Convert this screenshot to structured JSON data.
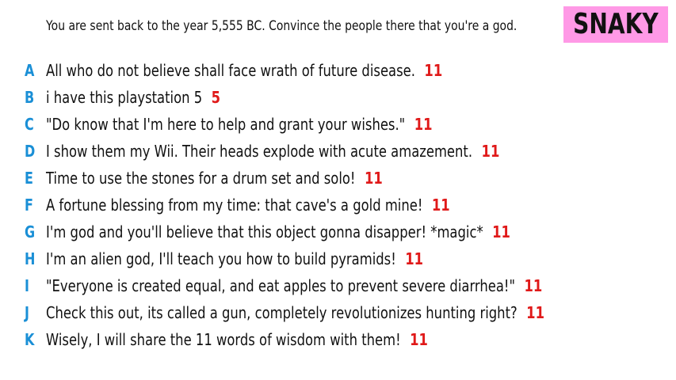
{
  "colors": {
    "letter": "#1a8fd6",
    "score": "#e01919",
    "text": "#111111",
    "brand_bg": "#ff99e6",
    "brand_text": "#111111"
  },
  "prompt": "You are sent back to the year 5,555 BC. Convince the people there that you're a god.",
  "brand": "SNAKY",
  "answers": [
    {
      "letter": "A",
      "text": "All who do not believe shall face wrath of future disease.",
      "score": "11"
    },
    {
      "letter": "B",
      "text": "i have this playstation 5",
      "score": "5"
    },
    {
      "letter": "C",
      "text": "\"Do know that I'm here to help and grant your wishes.\"",
      "score": "11"
    },
    {
      "letter": "D",
      "text": "I show them my Wii. Their heads explode with acute amazement.",
      "score": "11"
    },
    {
      "letter": "E",
      "text": "Time to use the stones for a drum set and solo!",
      "score": "11"
    },
    {
      "letter": "F",
      "text": "A fortune blessing from my time: that cave's a gold mine!",
      "score": "11"
    },
    {
      "letter": "G",
      "text": "I'm god and you'll believe that this object gonna disapper! *magic*",
      "score": "11"
    },
    {
      "letter": "H",
      "text": "I'm an alien god, I'll teach you how to build pyramids!",
      "score": "11"
    },
    {
      "letter": "I",
      "text": "\"Everyone is created equal, and eat apples to prevent severe diarrhea!\"",
      "score": "11"
    },
    {
      "letter": "J",
      "text": "Check this out, its called a gun, completely revolutionizes hunting right?",
      "score": "11"
    },
    {
      "letter": "K",
      "text": "Wisely, I will share the 11 words of wisdom with them!",
      "score": "11"
    }
  ]
}
